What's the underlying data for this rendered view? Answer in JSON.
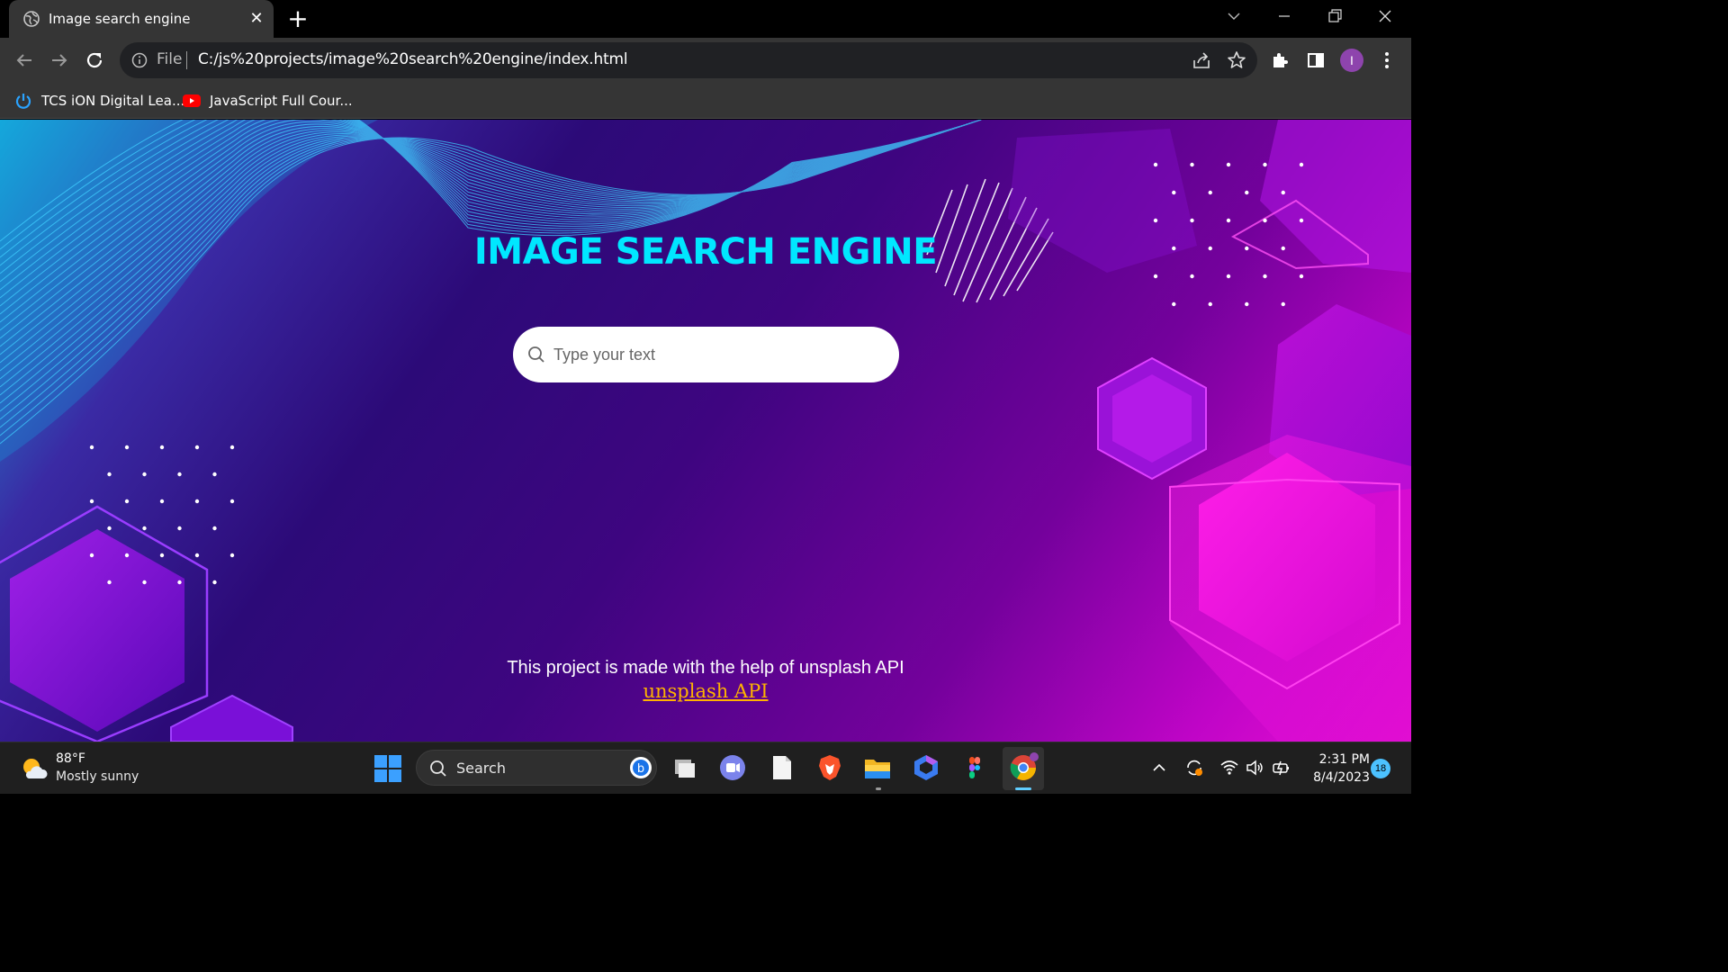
{
  "browser": {
    "tab_title": "Image search engine",
    "new_tab_label": "+",
    "url_scheme": "File",
    "url": "C:/js%20projects/image%20search%20engine/index.html",
    "profile_initial": "I",
    "bookmarks": [
      {
        "label": "TCS iON Digital Lea...",
        "icon": "power-icon"
      },
      {
        "label": "JavaScript Full Cour...",
        "icon": "youtube-icon"
      }
    ]
  },
  "page": {
    "heading": "IMAGE SEARCH ENGINE",
    "search_placeholder": "Type your text",
    "footer_text": "This project is made with the help of unsplash API",
    "footer_link": "unsplash API",
    "accent_color": "#00e7ff",
    "link_color": "#ffb300"
  },
  "taskbar": {
    "weather_temp": "88°F",
    "weather_condition": "Mostly sunny",
    "search_label": "Search",
    "time": "2:31 PM",
    "date": "8/4/2023",
    "notification_count": "18"
  }
}
